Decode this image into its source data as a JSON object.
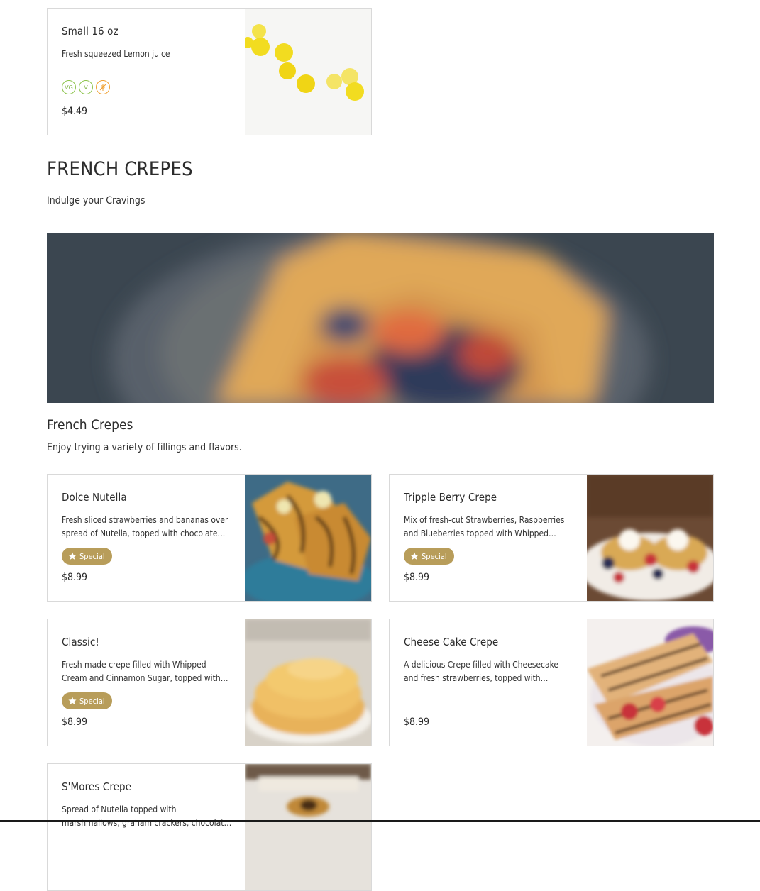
{
  "top_item": {
    "title": "Small 16 oz",
    "description": "Fresh squeezed Lemon juice",
    "price": "$4.49",
    "diet_icons": [
      "vegan-icon",
      "vegetarian-icon",
      "gluten-free-icon"
    ],
    "diet_labels": [
      "VG",
      "V",
      ""
    ]
  },
  "section": {
    "title": "FRENCH CREPES",
    "subtitle": "Indulge your Cravings"
  },
  "category": {
    "title": "French Crepes",
    "subtitle": "Enjoy trying a variety of fillings and flavors."
  },
  "items": [
    {
      "title": "Dolce Nutella",
      "description": "Fresh sliced strawberries and bananas over spread of Nutella, topped with chocolate drizzle and sugar powder.",
      "badge": "Special",
      "price": "$8.99"
    },
    {
      "title": "Tripple Berry Crepe",
      "description": "Mix of fresh-cut Strawberries, Raspberries and Blueberries topped with Whipped cream and chocolate drizzle.",
      "badge": "Special",
      "price": "$8.99"
    },
    {
      "title": "Classic!",
      "description": "Fresh made crepe filled with Whipped Cream and Cinnamon Sugar, topped with chocolate drizzle and sugar powder.",
      "badge": "Special",
      "price": "$8.99"
    },
    {
      "title": "Cheese Cake Crepe",
      "description": "A delicious Crepe filled with Cheesecake and fresh strawberries, topped with Whipped cream and chocolate drizzle.",
      "badge": "",
      "price": "$8.99"
    },
    {
      "title": "S'Mores Crepe",
      "description": "Spread of Nutella topped with marshmallows, graham crackers, chocolate drizzle and sugar powder!",
      "badge": "",
      "price": ""
    }
  ],
  "colors": {
    "badge": "#b89d5a",
    "card_border": "#d9d9d9",
    "vegan": "#8bc34a",
    "gluten_free": "#f0a030"
  }
}
